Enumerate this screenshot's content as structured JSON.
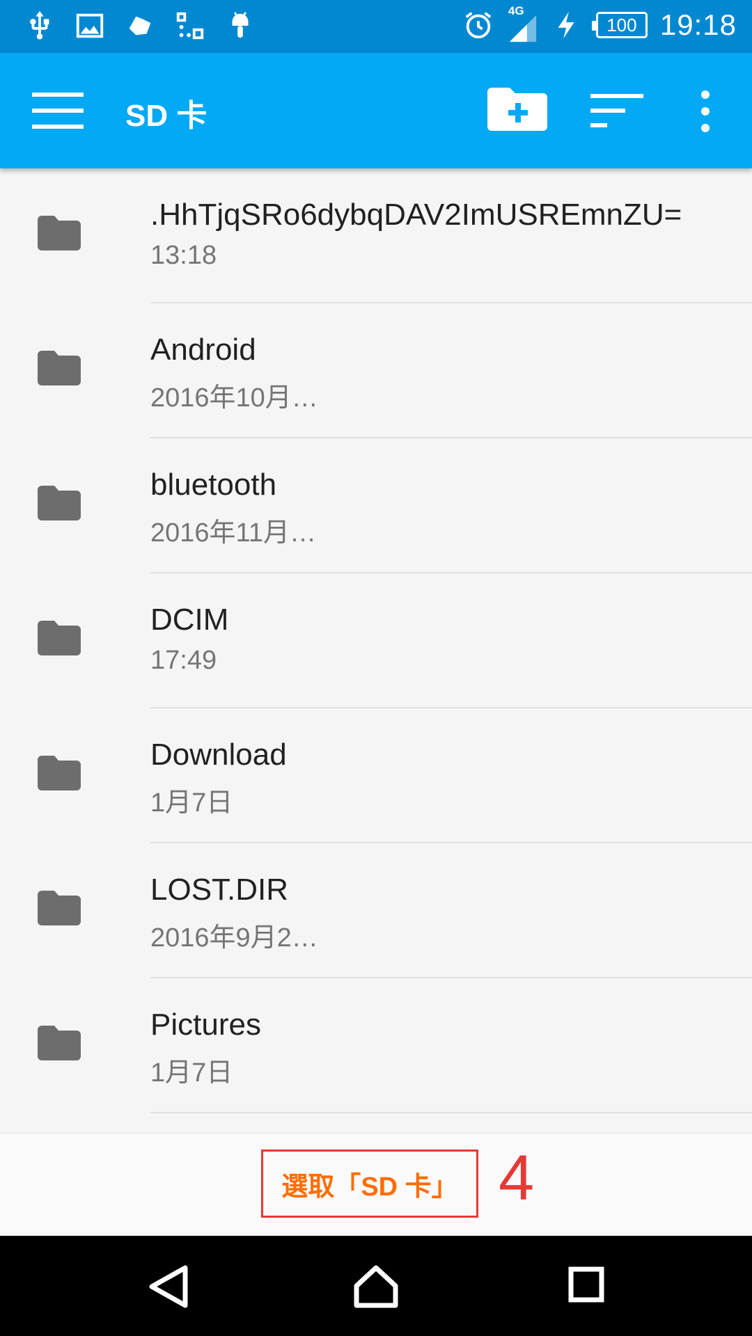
{
  "status_bar": {
    "time": "19:18",
    "battery_level": "100",
    "network_type": "4G",
    "left_icons": [
      "usb-icon",
      "image-icon",
      "cloud-icon",
      "app-icon",
      "android-icon"
    ],
    "right_icons": [
      "alarm-icon",
      "signal-icon",
      "charging-icon",
      "battery-icon"
    ]
  },
  "app_bar": {
    "title": "SD 卡",
    "actions": [
      "new-folder-icon",
      "sort-icon",
      "more-icon"
    ]
  },
  "files": [
    {
      "name": ".HhTjqSRo6dybqDAV2ImUSREmnZU=",
      "date": "13:18"
    },
    {
      "name": "Android",
      "date": "2016年10月…"
    },
    {
      "name": "bluetooth",
      "date": "2016年11月…"
    },
    {
      "name": "DCIM",
      "date": "17:49"
    },
    {
      "name": "Download",
      "date": "1月7日"
    },
    {
      "name": "LOST.DIR",
      "date": "2016年9月2…"
    },
    {
      "name": "Pictures",
      "date": "1月7日"
    }
  ],
  "select_bar": {
    "button_label": "選取「SD 卡」",
    "step_annotation": "4"
  },
  "colors": {
    "status_bar": "#0288d1",
    "app_bar": "#03a9f4",
    "select_label": "#ff6d00",
    "annotation_red": "#e53935",
    "folder_icon": "#6d6d6d"
  }
}
